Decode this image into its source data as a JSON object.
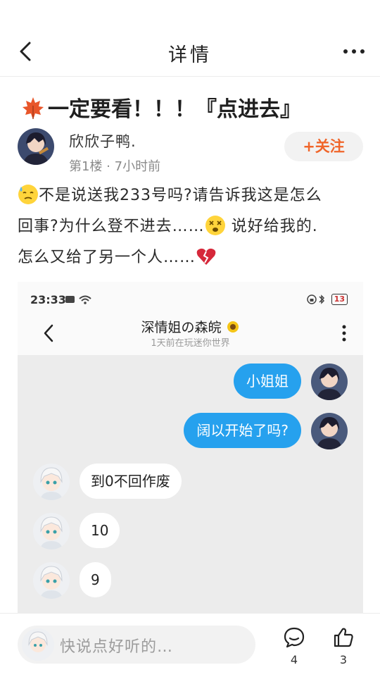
{
  "nav": {
    "title": "详情"
  },
  "post": {
    "title": "一定要看！！！『点进去』",
    "author": "欣欣子鸭.",
    "meta": "第1楼 · 7小时前",
    "follow_label": "+关注",
    "body": {
      "line1": "不是说送我233号吗?请告诉我这是怎么",
      "line2a": "回事?为什么登不进去……",
      "line2b": "说好给我的.",
      "line3": "怎么又给了另一个人……"
    }
  },
  "screenshot": {
    "time": "23:33",
    "battery": "13",
    "chat_name": "深情姐の森皖",
    "chat_status": "1天前在玩迷你世界",
    "messages": [
      {
        "side": "right",
        "text": "小姐姐"
      },
      {
        "side": "right",
        "text": "阔以开始了吗?"
      },
      {
        "side": "left",
        "text": "到0不回作废"
      },
      {
        "side": "left",
        "text": "10"
      },
      {
        "side": "left",
        "text": "9"
      }
    ]
  },
  "bottom": {
    "comment_placeholder": "快说点好听的…",
    "comment_count": "4",
    "like_count": "3"
  },
  "colors": {
    "accent_orange": "#f0662b",
    "bubble_blue": "#26a1ee"
  },
  "icons": [
    "back-icon",
    "more-icon",
    "maple-leaf-icon",
    "sweat-emoji-icon",
    "dizzy-emoji-icon",
    "broken-heart-icon",
    "comment-icon",
    "thumbs-up-icon"
  ]
}
